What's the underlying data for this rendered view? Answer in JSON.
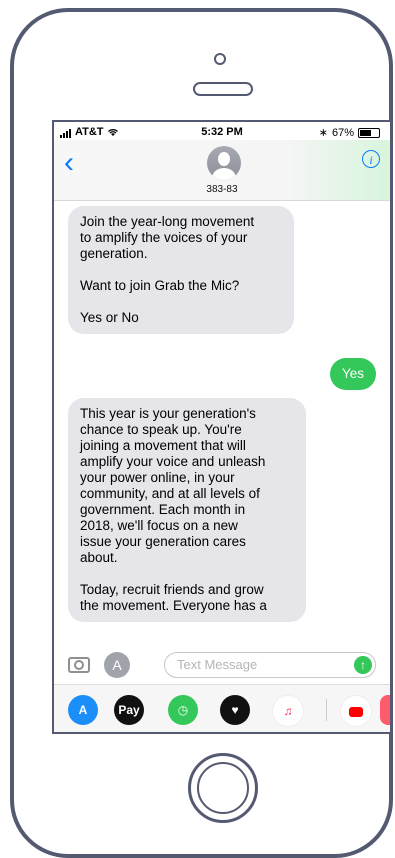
{
  "status": {
    "carrier": "AT&T",
    "time": "5:32 PM",
    "battery": "67%",
    "battery_level": 0.67,
    "bluetooth_icon": "bluetooth-icon",
    "wifi_icon": "wifi-icon"
  },
  "nav": {
    "back_icon": "chevron-left-icon",
    "contact_name": "383-83",
    "info_icon": "info-icon"
  },
  "messages": [
    {
      "direction": "in",
      "paragraphs": [
        "Join the year-long movement\nto amplify the voices of your\ngeneration.",
        "Want to join Grab the Mic?",
        "Yes or No"
      ]
    },
    {
      "direction": "out",
      "paragraphs": [
        "Yes"
      ]
    },
    {
      "direction": "in",
      "paragraphs": [
        "This year is your generation's\nchance to speak up. You're\njoining a movement that will\namplify your voice and unleash\nyour power online, in your\ncommunity, and at all levels of\ngovernment. Each month in\n2018, we'll focus on a new\nissue your generation cares\nabout.",
        "Today, recruit friends and grow\nthe movement. Everyone has a"
      ]
    }
  ],
  "input": {
    "placeholder": "Text Message",
    "camera_icon": "camera-icon",
    "apps_icon": "app-store-icon",
    "send_icon": "arrow-up-icon"
  },
  "apps": [
    {
      "name": "app-store-icon",
      "label": "",
      "color": "#1c8ef9"
    },
    {
      "name": "apple-pay-icon",
      "label": "Pay",
      "color": "#111111"
    },
    {
      "name": "clock-icon",
      "label": "",
      "color": "#34c759"
    },
    {
      "name": "heart-icon",
      "label": "",
      "color": "#111111"
    },
    {
      "name": "music-icon",
      "label": "♫",
      "color": "#ffffff"
    },
    {
      "name": "youtube-icon",
      "label": "",
      "color": "#ffffff"
    },
    {
      "name": "partial-app-icon",
      "label": "",
      "color": "#ff5a6e"
    }
  ],
  "colors": {
    "ios_blue": "#0a7aff",
    "imessage_green": "#34c759",
    "bubble_gray": "#e5e5ea",
    "frame": "#545a72"
  }
}
